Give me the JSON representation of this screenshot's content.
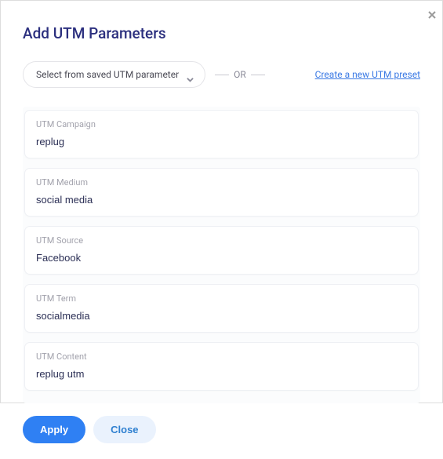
{
  "title": "Add UTM Parameters",
  "dropdown": {
    "placeholder": "Select from saved UTM parameter"
  },
  "or_label": "OR",
  "create_link_label": "Create a new UTM preset",
  "fields": {
    "campaign": {
      "label": "UTM Campaign",
      "value": "replug"
    },
    "medium": {
      "label": "UTM Medium",
      "value": "social media"
    },
    "source": {
      "label": "UTM Source",
      "value": "Facebook"
    },
    "term": {
      "label": "UTM Term",
      "value": "socialmedia"
    },
    "content": {
      "label": "UTM Content",
      "value": "replug utm"
    }
  },
  "buttons": {
    "apply": "Apply",
    "close": "Close"
  }
}
